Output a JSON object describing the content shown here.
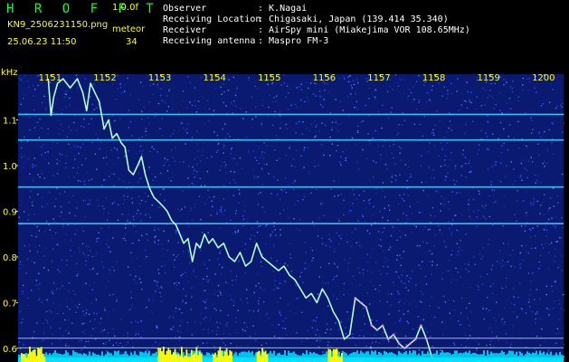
{
  "header": {
    "app_title": "H R O F F T",
    "version": "1.0.0f",
    "filename": "KN9_2506231150.png",
    "meteor_label": "meteor",
    "datetime": "25.06.23 11:50",
    "meteor_count": "34",
    "info": [
      {
        "key": "Observer",
        "value": ": K.Nagai"
      },
      {
        "key": "Receiving Location",
        "value": ": Chigasaki, Japan (139.414 35.340)"
      },
      {
        "key": "Receiver",
        "value": ": AirSpy mini (Miakejima VOR 108.65MHz)"
      },
      {
        "key": "Receiving antenna",
        "value": ": Maspro FM-3"
      }
    ]
  },
  "colors": {
    "header_green": "#00ff3c",
    "header_yellow": "#ffff00",
    "axis_yellow": "#ffff00",
    "background_blue": "#0a1a70",
    "trace": "#b0ffd0",
    "carrier_line": "#40d0ff",
    "bottom_cyan": "#00e0ff",
    "bottom_yellow": "#ffff00"
  },
  "chart_data": {
    "type": "line",
    "ylabel": "kHz",
    "ylim": [
      0.57,
      1.2
    ],
    "x_ticks": [
      "1151",
      "1152",
      "1153",
      "1154",
      "1155",
      "1156",
      "1157",
      "1158",
      "1159",
      "1200"
    ],
    "y_ticks": [
      "0.6",
      "0.7",
      "0.8",
      "0.9",
      "1.0",
      "1.1"
    ],
    "x_minutes": [
      0,
      1,
      2,
      3,
      4,
      5,
      6,
      7,
      8,
      9
    ],
    "xlim": [
      -0.6,
      9.35
    ],
    "grid": false,
    "horizontal_lines_khz": [
      1.112,
      1.056,
      0.953,
      0.873,
      0.622,
      0.601
    ],
    "series": [
      {
        "x": [
          -0.05,
          0.0,
          0.05,
          0.12,
          0.22,
          0.35,
          0.48,
          0.58,
          0.65,
          0.72,
          0.8,
          0.88,
          0.97,
          1.05,
          1.12,
          1.2,
          1.28,
          1.35,
          1.42,
          1.5,
          1.58,
          1.65,
          1.72,
          1.8,
          1.88,
          1.97,
          2.05,
          2.12,
          2.2,
          2.28,
          2.35,
          2.42,
          2.5,
          2.58,
          2.65,
          2.72,
          2.8,
          2.88,
          2.95,
          3.05,
          3.15,
          3.25,
          3.35,
          3.45,
          3.55,
          3.65,
          3.75,
          3.85,
          3.95,
          4.05,
          4.15,
          4.25,
          4.35,
          4.45,
          4.55,
          4.65,
          4.75,
          4.85,
          4.95,
          5.05,
          5.15,
          5.25,
          5.35,
          5.45,
          5.55,
          5.65,
          5.75,
          5.85,
          5.95,
          6.05,
          6.15,
          6.25,
          6.35,
          6.45,
          6.55,
          6.65,
          6.75,
          6.85,
          6.95,
          7.05
        ],
        "y": [
          1.19,
          1.11,
          1.15,
          1.18,
          1.19,
          1.17,
          1.19,
          1.16,
          1.12,
          1.18,
          1.16,
          1.14,
          1.08,
          1.1,
          1.06,
          1.07,
          1.05,
          1.04,
          0.99,
          0.98,
          1.0,
          1.02,
          0.98,
          0.95,
          0.93,
          0.92,
          0.91,
          0.9,
          0.88,
          0.87,
          0.85,
          0.83,
          0.84,
          0.79,
          0.83,
          0.82,
          0.85,
          0.83,
          0.84,
          0.82,
          0.83,
          0.8,
          0.79,
          0.81,
          0.78,
          0.79,
          0.83,
          0.8,
          0.79,
          0.78,
          0.77,
          0.78,
          0.76,
          0.75,
          0.73,
          0.71,
          0.72,
          0.7,
          0.73,
          0.71,
          0.68,
          0.66,
          0.62,
          0.63,
          0.71,
          0.7,
          0.69,
          0.65,
          0.64,
          0.65,
          0.62,
          0.63,
          0.61,
          0.6,
          0.61,
          0.62,
          0.65,
          0.62,
          0.58,
          0.57
        ]
      }
    ]
  }
}
